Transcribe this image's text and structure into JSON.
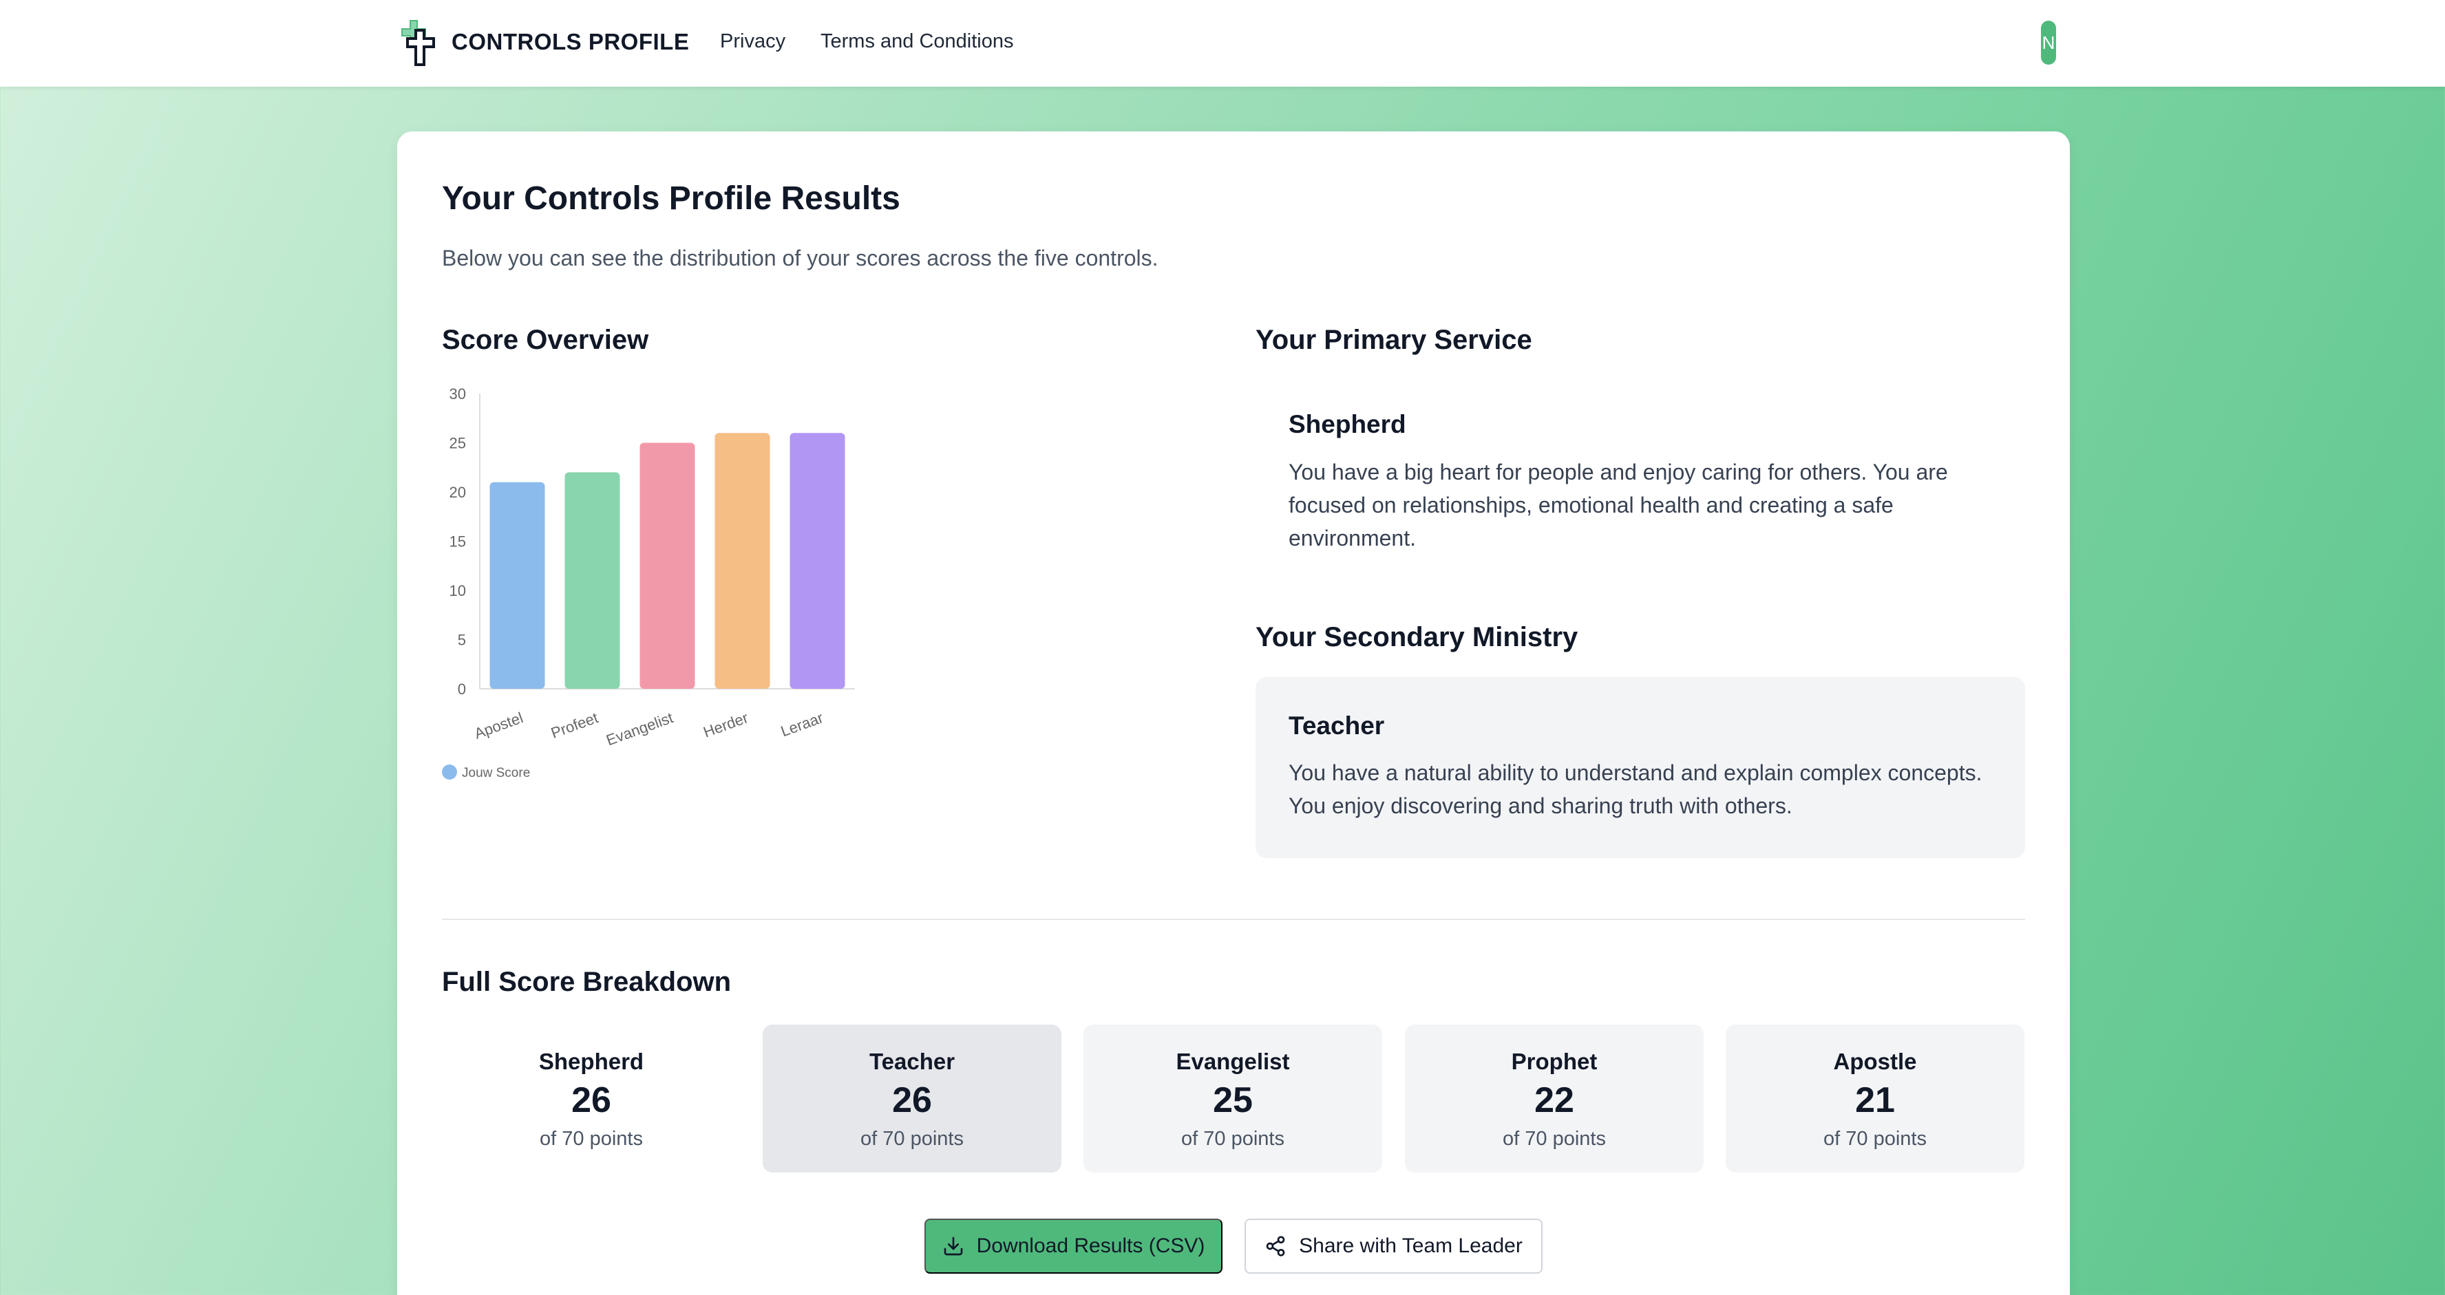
{
  "header": {
    "brand": "CONTROLS PROFILE",
    "nav": [
      "Privacy",
      "Terms and Conditions"
    ],
    "avatar_initial": "N",
    "logo_icon": "cross-logo-icon"
  },
  "main": {
    "title": "Your Controls Profile Results",
    "subtitle": "Below you can see the distribution of your scores across the five controls.",
    "chart_heading": "Score Overview",
    "primary_heading": "Your Primary Service",
    "primary": {
      "name": "Shepherd",
      "description": "You have a big heart for people and enjoy caring for others. You are focused on relationships, emotional health and creating a safe environment."
    },
    "secondary_heading": "Your Secondary Ministry",
    "secondary": {
      "name": "Teacher",
      "description": "You have a natural ability to understand and explain complex concepts. You enjoy discovering and sharing truth with others."
    },
    "breakdown_heading": "Full Score Breakdown",
    "breakdown": [
      {
        "name": "Shepherd",
        "score": "26",
        "of": "of 70 points"
      },
      {
        "name": "Teacher",
        "score": "26",
        "of": "of 70 points"
      },
      {
        "name": "Evangelist",
        "score": "25",
        "of": "of 70 points"
      },
      {
        "name": "Prophet",
        "score": "22",
        "of": "of 70 points"
      },
      {
        "name": "Apostle",
        "score": "21",
        "of": "of 70 points"
      }
    ],
    "download_label": "Download Results (CSV)",
    "share_label": "Share with Team Leader"
  },
  "colors": {
    "accent": "#4fb97c",
    "tile_selected": "#e5e7eb",
    "tile_default": "#f3f4f6"
  },
  "chart_data": {
    "type": "bar",
    "categories": [
      "Apostel",
      "Profeet",
      "Evangelist",
      "Herder",
      "Leraar"
    ],
    "series": [
      {
        "name": "Jouw Score",
        "values": [
          21,
          22,
          25,
          26,
          26
        ]
      }
    ],
    "bar_colors": [
      "#8bbbed",
      "#88d5ae",
      "#f299a9",
      "#f5be85",
      "#b196f4"
    ],
    "ylim": [
      0,
      30
    ],
    "yticks": [
      0,
      5,
      10,
      15,
      20,
      25,
      30
    ],
    "legend_position": "bottom-left",
    "grid": false
  }
}
